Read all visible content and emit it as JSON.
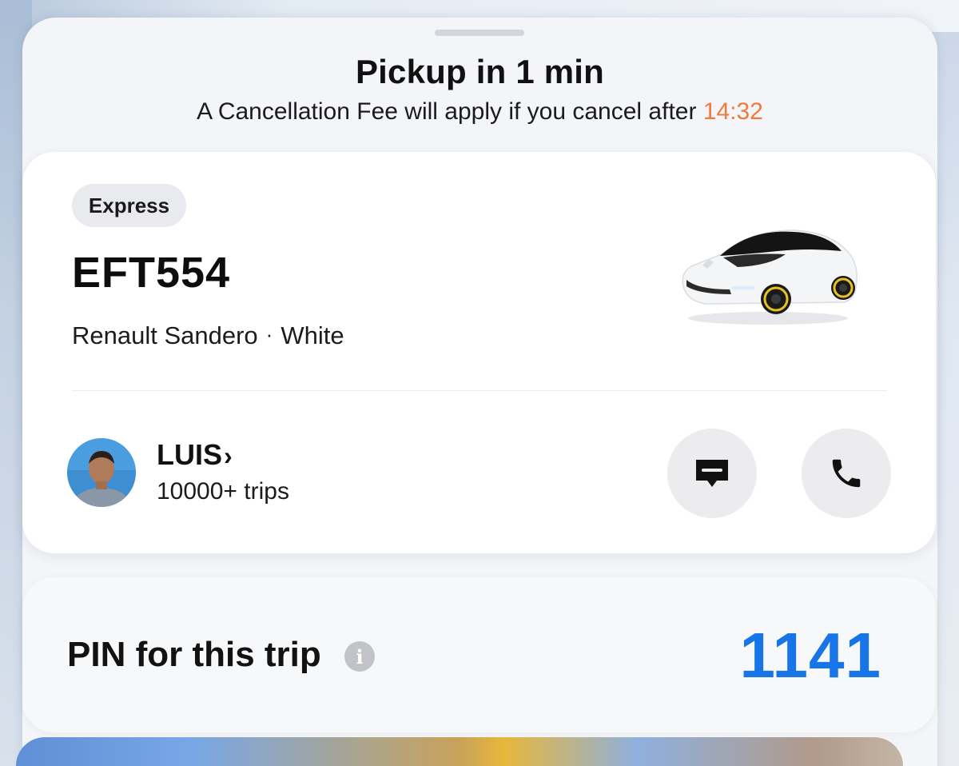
{
  "header": {
    "title": "Pickup in 1 min",
    "subtitle_prefix": "A Cancellation Fee will apply if you cancel after",
    "cancel_time": "14:32",
    "accent_color": "#f07a3b"
  },
  "vehicle": {
    "service_badge": "Express",
    "plate": "EFT554",
    "model": "Renault Sandero",
    "separator": "·",
    "color": "White",
    "image_icon": "car-image"
  },
  "driver": {
    "name": "LUIS",
    "chevron": "›",
    "trips": "10000+ trips",
    "message_icon": "message-icon",
    "call_icon": "phone-icon"
  },
  "pin": {
    "label": "PIN for this trip",
    "info_glyph": "i",
    "value": "1141",
    "value_color": "#1775e8"
  }
}
